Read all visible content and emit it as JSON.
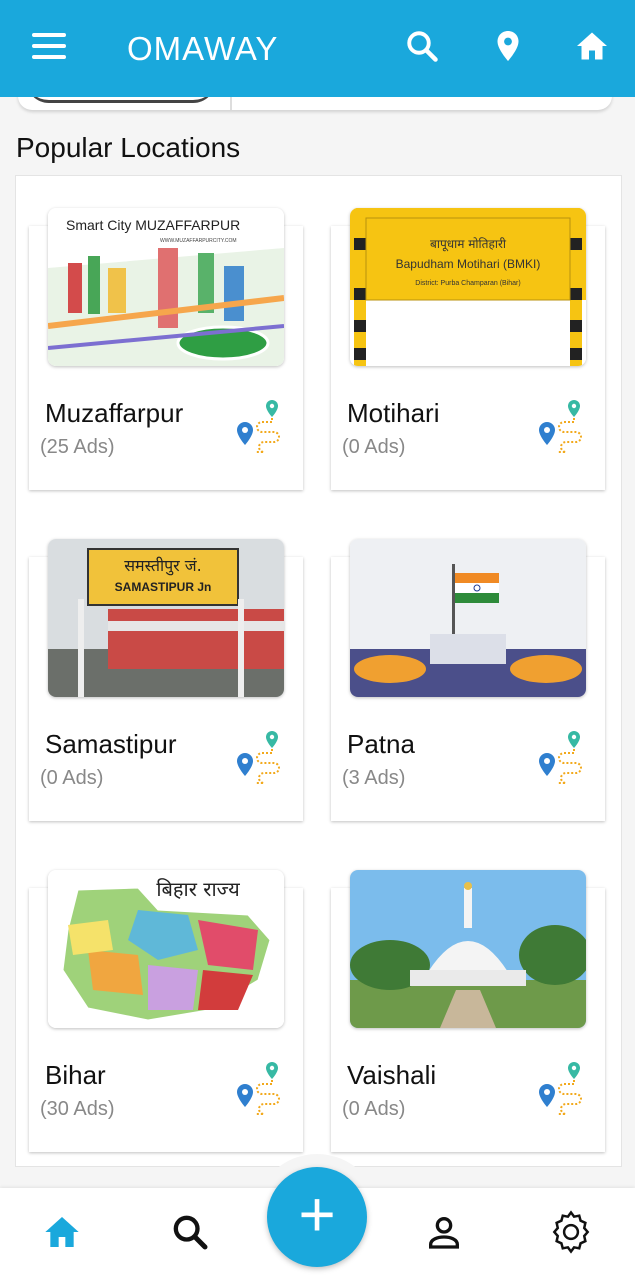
{
  "app_bar": {
    "title": "OMAWAY",
    "icons": [
      "menu-icon",
      "search-icon",
      "location-pin-icon",
      "home-icon"
    ]
  },
  "section": {
    "title": "Popular Locations"
  },
  "locations": [
    {
      "name": "Muzaffarpur",
      "ads": "(25 Ads)",
      "banner": "Smart City MUZAFFARPUR",
      "banner_sub": "WWW.MUZAFFARPURCITY.COM"
    },
    {
      "name": "Motihari",
      "ads": "(0 Ads)",
      "sign_hindi": "बापूधाम मोतिहारी",
      "sign_en": "Bapudham Motihari (BMKI)",
      "sign_sub": "District: Purba Champaran (Bihar)"
    },
    {
      "name": "Samastipur",
      "ads": "(0 Ads)",
      "sign_hindi": "समस्तीपुर जं.",
      "sign_en": "SAMASTIPUR Jn"
    },
    {
      "name": "Patna",
      "ads": "(3 Ads)"
    },
    {
      "name": "Bihar",
      "ads": "(30 Ads)",
      "map_title": "बिहार राज्य"
    },
    {
      "name": "Vaishali",
      "ads": "(0 Ads)"
    }
  ],
  "bottom_nav": {
    "items": [
      "home-icon",
      "search-icon",
      "add-icon",
      "profile-icon",
      "settings-icon"
    ],
    "accent": "#1aa8dc"
  },
  "colors": {
    "primary": "#1aa8dc",
    "background": "#f5f5f5"
  }
}
